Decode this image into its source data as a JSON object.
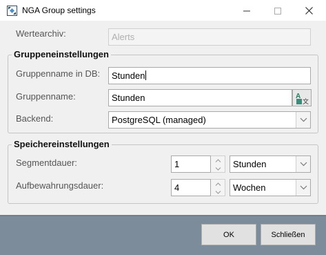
{
  "window": {
    "title": "NGA Group settings",
    "app_icon": "app-icon",
    "controls": [
      "minimize-icon",
      "maximize-icon",
      "close-icon"
    ]
  },
  "archive": {
    "label": "Wertearchiv:",
    "value": "Alerts"
  },
  "group_settings": {
    "title": "Gruppeneinstellungen",
    "db_name_label": "Gruppenname in DB:",
    "db_name_value": "Stunden",
    "name_label": "Gruppenname:",
    "name_value": "Stunden",
    "translate_icon": "translate-icon",
    "backend_label": "Backend:",
    "backend_value": "PostgreSQL (managed)"
  },
  "storage_settings": {
    "title": "Speichereinstellungen",
    "segment_label": "Segmentdauer:",
    "segment_value": "1",
    "segment_unit": "Stunden",
    "retention_label": "Aufbewahrungsdauer:",
    "retention_value": "4",
    "retention_unit": "Wochen"
  },
  "footer": {
    "ok_label": "OK",
    "close_label": "Schließen"
  },
  "colors": {
    "panel": "#f0f0f0",
    "footer": "#7d8c9b",
    "border": "#a9a9a9"
  }
}
